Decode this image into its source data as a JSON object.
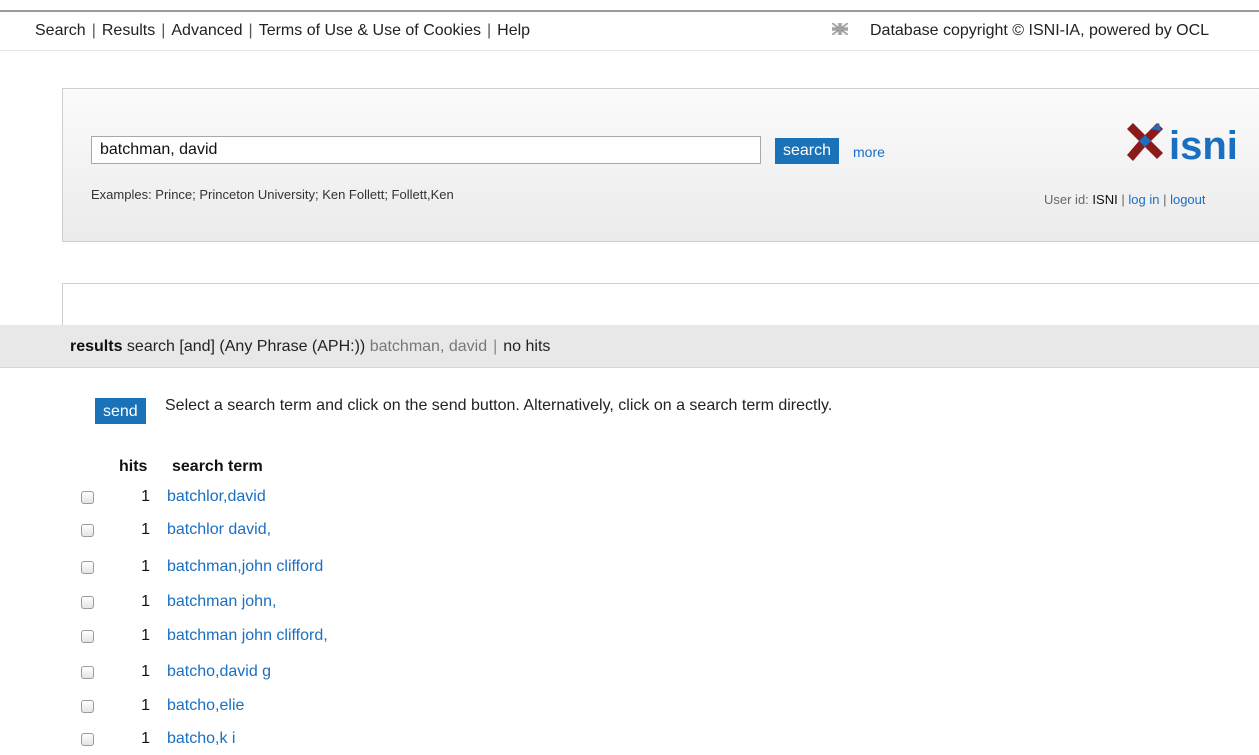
{
  "nav": {
    "links": [
      "Search",
      "Results",
      "Advanced",
      "Terms of Use & Use of Cookies",
      "Help"
    ],
    "separator": "|",
    "copyright": "Database copyright © ISNI-IA, powered by OCL",
    "flag_icon": "uk-flag-icon"
  },
  "search": {
    "value": "batchman, david",
    "button_label": "search",
    "more_label": "more",
    "examples": "Examples: Prince; Princeton University; Ken Follett; Follett,Ken"
  },
  "logo": {
    "text": "isni",
    "icon": "isni-logo-icon",
    "colors": {
      "mark": "#8b1a1a",
      "text": "#1a6fc1"
    }
  },
  "user": {
    "prefix": "User id:",
    "id": "ISNI",
    "sep": "|",
    "login_label": "log in",
    "logout_label": "logout"
  },
  "results": {
    "label": "results",
    "query_prefix": "search [and]  (Any Phrase (APH:))",
    "query_term": "batchman, david",
    "sep": "|",
    "status": "no hits"
  },
  "send": {
    "button_label": "send",
    "instruction": "Select a search term and click on the send button. Alternatively, click on a search term directly."
  },
  "table": {
    "headers": {
      "hits": "hits",
      "term": "search term"
    },
    "rows": [
      {
        "hits": "1",
        "term": "batchlor,david"
      },
      {
        "hits": "1",
        "term": "batchlor david,"
      },
      {
        "hits": "1",
        "term": "batchman,john clifford"
      },
      {
        "hits": "1",
        "term": "batchman john,"
      },
      {
        "hits": "1",
        "term": "batchman john clifford,"
      },
      {
        "hits": "1",
        "term": "batcho,david g"
      },
      {
        "hits": "1",
        "term": "batcho,elie"
      },
      {
        "hits": "1",
        "term": "batcho,k i"
      }
    ]
  },
  "colors": {
    "accent": "#1a73b8",
    "link": "#1a6fc1",
    "bar": "#e8e8e8"
  }
}
